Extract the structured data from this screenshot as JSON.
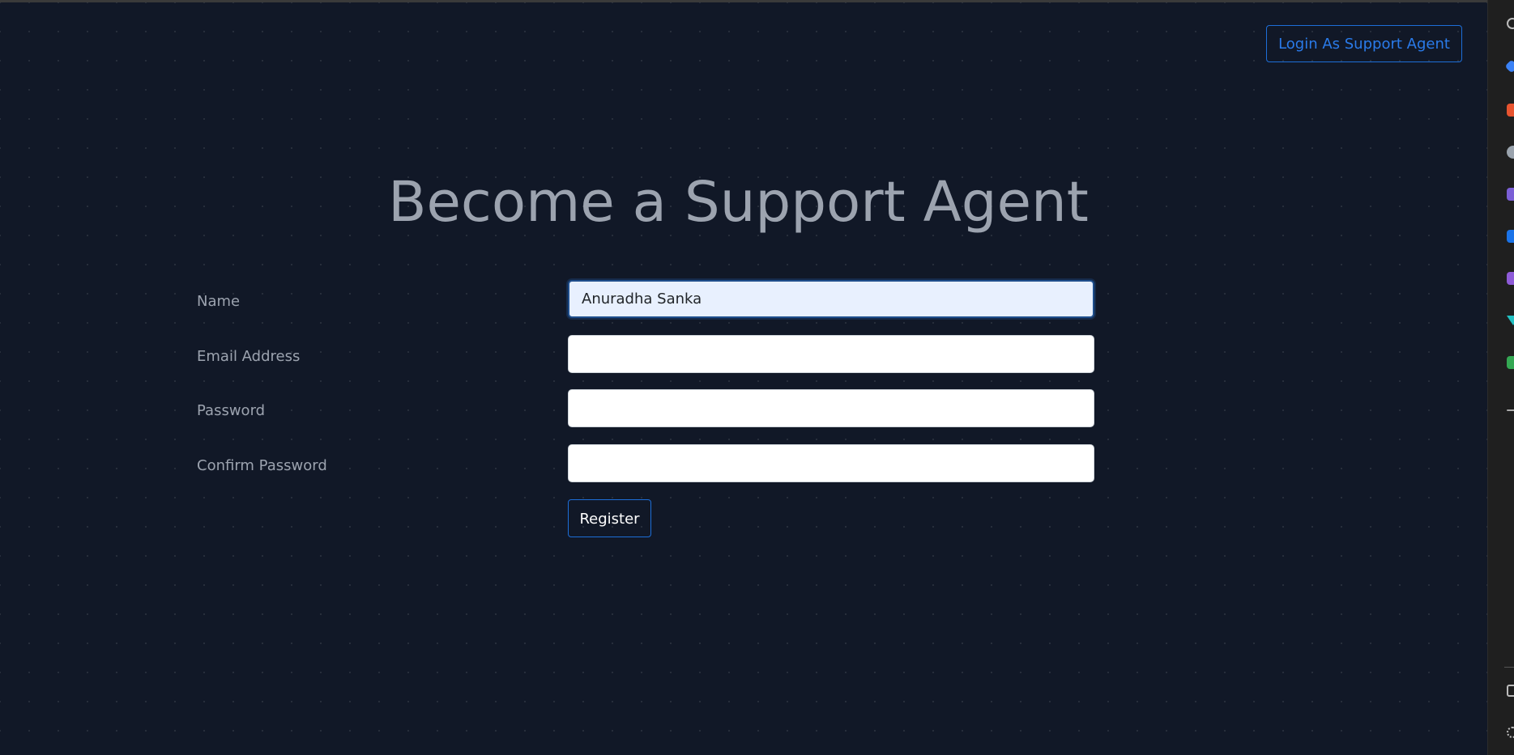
{
  "header": {
    "login_label": "Login As Support Agent"
  },
  "main": {
    "title": "Become a Support Agent"
  },
  "form": {
    "name": {
      "label": "Name",
      "value": "Anuradha Sanka"
    },
    "email": {
      "label": "Email Address",
      "value": ""
    },
    "password": {
      "label": "Password",
      "value": ""
    },
    "confirm_password": {
      "label": "Confirm Password",
      "value": ""
    },
    "submit_label": "Register"
  },
  "theme": {
    "background": "#111827",
    "label_color": "#9ca3af",
    "accent": "#1d6ed8"
  },
  "side_strip": {
    "icons": [
      "search-icon",
      "diamond-icon",
      "toolbox-icon",
      "person-icon",
      "cube-icon",
      "outlook-icon",
      "stack-icon",
      "funnel-icon",
      "drive-icon",
      "add-icon",
      "window-icon",
      "settings-icon"
    ]
  }
}
